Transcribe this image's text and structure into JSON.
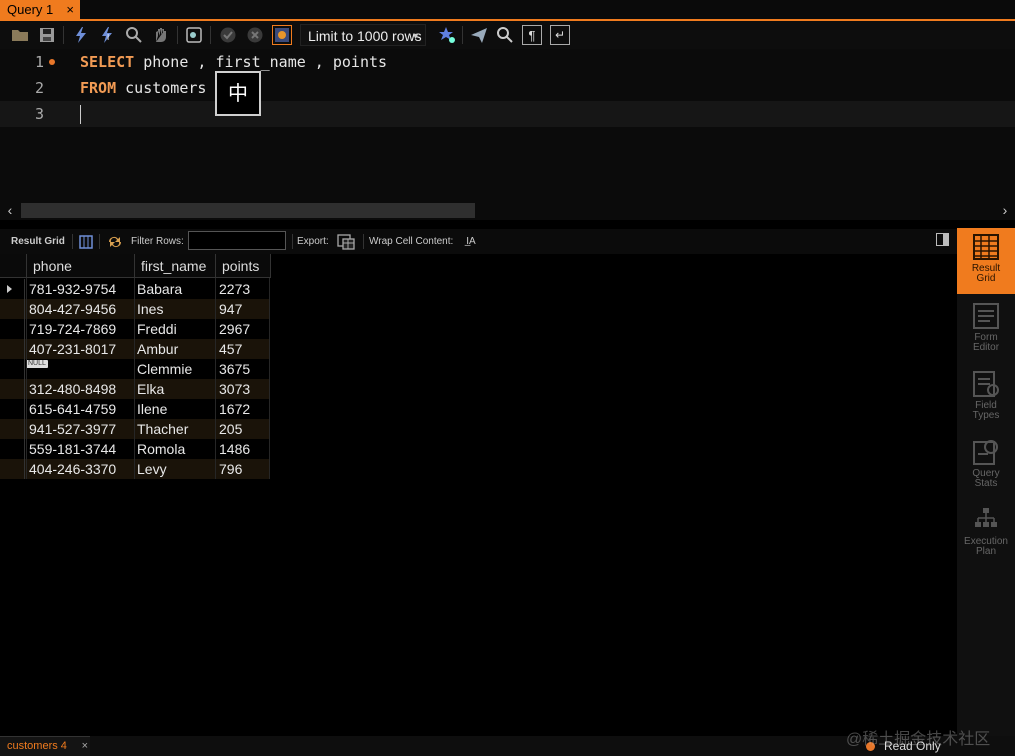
{
  "tab": {
    "title": "Query 1",
    "close": "×"
  },
  "toolbar": {
    "limit_label": "Limit to 1000 rows",
    "icons": [
      "folder-icon",
      "save-icon",
      "execute-icon",
      "execute-current-icon",
      "explain-icon",
      "stop-icon",
      "toggle-output-icon",
      "commit-icon",
      "rollback-icon",
      "autocommit-icon",
      "beautify-icon",
      "find-icon",
      "invisibles-icon",
      "wrap-icon"
    ]
  },
  "editor": {
    "lines": [
      {
        "num": "1",
        "kw": "SELECT",
        "rest": " phone , first_name , points"
      },
      {
        "num": "2",
        "kw": "FROM",
        "rest": " customers"
      },
      {
        "num": "3",
        "kw": "",
        "rest": ""
      }
    ],
    "ime_char": "中"
  },
  "result_toolbar": {
    "result_grid": "Result Grid",
    "filter_rows": "Filter Rows:",
    "filter_value": "",
    "export": "Export:",
    "wrap": "Wrap Cell Content:"
  },
  "grid": {
    "columns": [
      "phone",
      "first_name",
      "points"
    ],
    "null_label": "NULL",
    "rows": [
      {
        "phone": "781-932-9754",
        "first_name": "Babara",
        "points": "2273"
      },
      {
        "phone": "804-427-9456",
        "first_name": "Ines",
        "points": "947"
      },
      {
        "phone": "719-724-7869",
        "first_name": "Freddi",
        "points": "2967"
      },
      {
        "phone": "407-231-8017",
        "first_name": "Ambur",
        "points": "457"
      },
      {
        "phone": null,
        "first_name": "Clemmie",
        "points": "3675"
      },
      {
        "phone": "312-480-8498",
        "first_name": "Elka",
        "points": "3073"
      },
      {
        "phone": "615-641-4759",
        "first_name": "Ilene",
        "points": "1672"
      },
      {
        "phone": "941-527-3977",
        "first_name": "Thacher",
        "points": "205"
      },
      {
        "phone": "559-181-3744",
        "first_name": "Romola",
        "points": "1486"
      },
      {
        "phone": "404-246-3370",
        "first_name": "Levy",
        "points": "796"
      }
    ]
  },
  "side_panel": [
    {
      "line1": "Result",
      "line2": "Grid",
      "active": true
    },
    {
      "line1": "Form",
      "line2": "Editor",
      "active": false
    },
    {
      "line1": "Field",
      "line2": "Types",
      "active": false
    },
    {
      "line1": "Query",
      "line2": "Stats",
      "active": false
    },
    {
      "line1": "Execution",
      "line2": "Plan",
      "active": false
    }
  ],
  "bottom": {
    "tab_label": "customers 4",
    "close": "×",
    "status": "Read Only",
    "watermark": "@稀土掘金技术社区"
  },
  "colors": {
    "accent": "#f07b1e",
    "keyword": "#f29b54",
    "row_alt": "#1a1309"
  }
}
